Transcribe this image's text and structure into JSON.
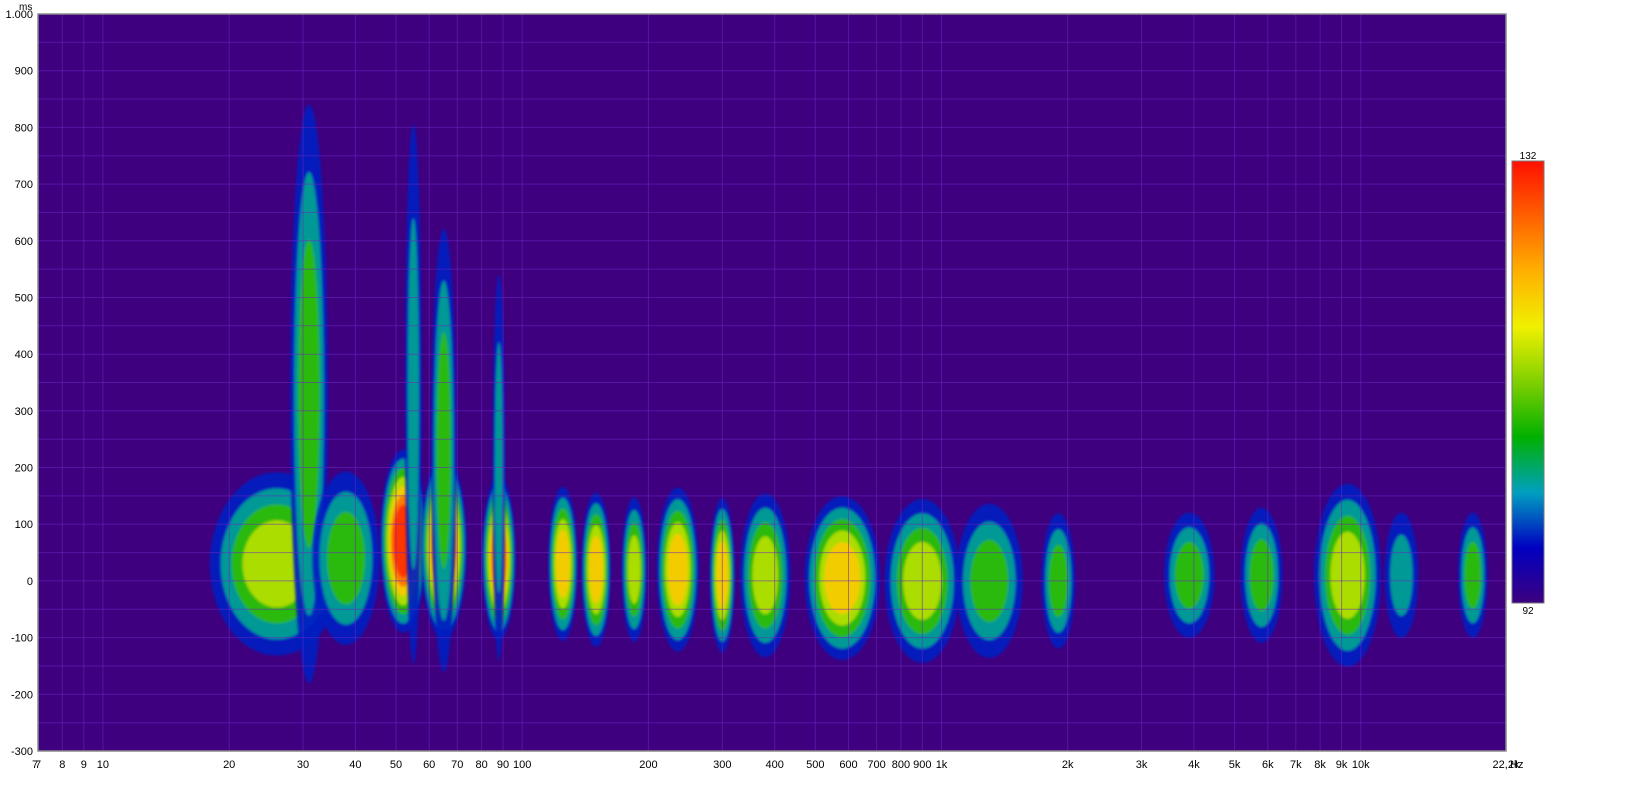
{
  "chart_data": {
    "type": "heatmap",
    "xlabel_unit": "Hz",
    "ylabel_unit": "ms",
    "x_scale": "log",
    "xlim": [
      7,
      22200
    ],
    "ylim": [
      -300,
      1000
    ],
    "grid": true,
    "x_ticks": [
      {
        "value": 7,
        "label": "7"
      },
      {
        "value": 8,
        "label": "8"
      },
      {
        "value": 9,
        "label": "9"
      },
      {
        "value": 10,
        "label": "10"
      },
      {
        "value": 20,
        "label": "20"
      },
      {
        "value": 30,
        "label": "30"
      },
      {
        "value": 40,
        "label": "40"
      },
      {
        "value": 50,
        "label": "50"
      },
      {
        "value": 60,
        "label": "60"
      },
      {
        "value": 70,
        "label": "70"
      },
      {
        "value": 80,
        "label": "80"
      },
      {
        "value": 90,
        "label": "90"
      },
      {
        "value": 100,
        "label": "100"
      },
      {
        "value": 200,
        "label": "200"
      },
      {
        "value": 300,
        "label": "300"
      },
      {
        "value": 400,
        "label": "400"
      },
      {
        "value": 500,
        "label": "500"
      },
      {
        "value": 600,
        "label": "600"
      },
      {
        "value": 700,
        "label": "700"
      },
      {
        "value": 800,
        "label": "800"
      },
      {
        "value": 900,
        "label": "900"
      },
      {
        "value": 1000,
        "label": "1k"
      },
      {
        "value": 2000,
        "label": "2k"
      },
      {
        "value": 3000,
        "label": "3k"
      },
      {
        "value": 4000,
        "label": "4k"
      },
      {
        "value": 5000,
        "label": "5k"
      },
      {
        "value": 6000,
        "label": "6k"
      },
      {
        "value": 7000,
        "label": "7k"
      },
      {
        "value": 8000,
        "label": "8k"
      },
      {
        "value": 9000,
        "label": "9k"
      },
      {
        "value": 10000,
        "label": "10k"
      },
      {
        "value": 22200,
        "label": "22,2k"
      }
    ],
    "extra_x_label_left": "7",
    "y_ticks": [
      {
        "value": 1000,
        "label": "1.000"
      },
      {
        "value": 900,
        "label": "900"
      },
      {
        "value": 800,
        "label": "800"
      },
      {
        "value": 700,
        "label": "700"
      },
      {
        "value": 600,
        "label": "600"
      },
      {
        "value": 500,
        "label": "500"
      },
      {
        "value": 400,
        "label": "400"
      },
      {
        "value": 300,
        "label": "300"
      },
      {
        "value": 200,
        "label": "200"
      },
      {
        "value": 100,
        "label": "100"
      },
      {
        "value": 0,
        "label": "0"
      },
      {
        "value": -100,
        "label": "-100"
      },
      {
        "value": -200,
        "label": "-200"
      },
      {
        "value": -300,
        "label": "-300"
      }
    ],
    "colorbar": {
      "min": 92,
      "max": 132,
      "min_label": "92",
      "max_label": "132",
      "colors": [
        "#3d0080",
        "#0000c0",
        "#00a0c0",
        "#00b000",
        "#80d000",
        "#f0f000",
        "#ffb000",
        "#ff6000",
        "#ff1000"
      ]
    },
    "background_color": "#3f007f",
    "grid_color": "#6a26c4",
    "blobs": [
      {
        "f": 26,
        "t": 30,
        "fw": 0.16,
        "tw": 95,
        "level": 0.5
      },
      {
        "f": 31,
        "t": 330,
        "fw": 0.045,
        "tw": 300,
        "level": 0.38
      },
      {
        "f": 38,
        "t": 40,
        "fw": 0.08,
        "tw": 90,
        "level": 0.48
      },
      {
        "f": 52,
        "t": 70,
        "fw": 0.055,
        "tw": 95,
        "level": 0.97
      },
      {
        "f": 55,
        "t": 330,
        "fw": 0.02,
        "tw": 280,
        "level": 0.35
      },
      {
        "f": 65,
        "t": 60,
        "fw": 0.055,
        "tw": 95,
        "level": 0.98
      },
      {
        "f": 65,
        "t": 230,
        "fw": 0.03,
        "tw": 230,
        "level": 0.42
      },
      {
        "f": 88,
        "t": 40,
        "fw": 0.04,
        "tw": 85,
        "level": 0.85
      },
      {
        "f": 88,
        "t": 200,
        "fw": 0.015,
        "tw": 200,
        "level": 0.35
      },
      {
        "f": 125,
        "t": 30,
        "fw": 0.035,
        "tw": 80,
        "level": 0.78
      },
      {
        "f": 150,
        "t": 20,
        "fw": 0.035,
        "tw": 80,
        "level": 0.78
      },
      {
        "f": 185,
        "t": 20,
        "fw": 0.03,
        "tw": 75,
        "level": 0.62
      },
      {
        "f": 235,
        "t": 20,
        "fw": 0.05,
        "tw": 85,
        "level": 0.7
      },
      {
        "f": 300,
        "t": 10,
        "fw": 0.03,
        "tw": 80,
        "level": 0.74
      },
      {
        "f": 380,
        "t": 10,
        "fw": 0.06,
        "tw": 85,
        "level": 0.6
      },
      {
        "f": 580,
        "t": 5,
        "fw": 0.09,
        "tw": 85,
        "level": 0.68
      },
      {
        "f": 900,
        "t": 0,
        "fw": 0.09,
        "tw": 85,
        "level": 0.5
      },
      {
        "f": 1300,
        "t": 0,
        "fw": 0.08,
        "tw": 80,
        "level": 0.46
      },
      {
        "f": 1900,
        "t": 0,
        "fw": 0.04,
        "tw": 70,
        "level": 0.36
      },
      {
        "f": 3900,
        "t": 10,
        "fw": 0.06,
        "tw": 65,
        "level": 0.36
      },
      {
        "f": 5800,
        "t": 10,
        "fw": 0.05,
        "tw": 70,
        "level": 0.38
      },
      {
        "f": 9300,
        "t": 10,
        "fw": 0.08,
        "tw": 95,
        "level": 0.55
      },
      {
        "f": 12500,
        "t": 10,
        "fw": 0.04,
        "tw": 65,
        "level": 0.3
      },
      {
        "f": 18500,
        "t": 10,
        "fw": 0.035,
        "tw": 65,
        "level": 0.4
      }
    ]
  }
}
